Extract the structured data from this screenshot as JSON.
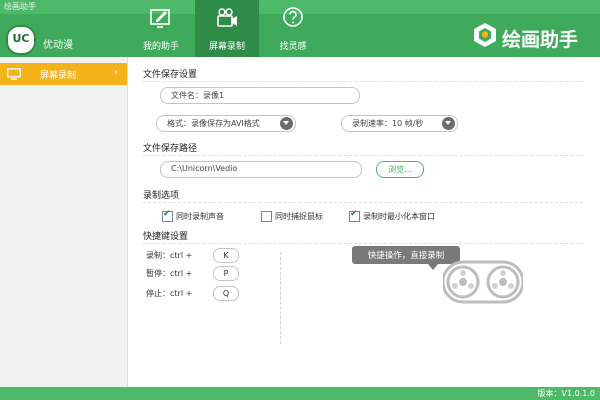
{
  "window": {
    "title": "绘画助手"
  },
  "user": {
    "logo_text": "UC",
    "name": "优动漫"
  },
  "tabs": [
    {
      "label": "我的助手",
      "icon": "palette-icon",
      "active": false
    },
    {
      "label": "屏幕录制",
      "icon": "video-camera-icon",
      "active": true
    },
    {
      "label": "找灵感",
      "icon": "question-icon",
      "active": false
    }
  ],
  "brand": {
    "text": "绘画助手"
  },
  "sidebar": {
    "items": [
      {
        "label": "屏幕录制",
        "icon": "monitor-icon",
        "arrow": "›"
      }
    ]
  },
  "file_save": {
    "title": "文件保存设置",
    "filename_label": "文件名：",
    "filename_value": "录像1",
    "format_label": "格式：",
    "format_value": "录像保存为AVI格式",
    "rate_label": "录制速率：",
    "rate_value": "10 帧/秒"
  },
  "save_path": {
    "title": "文件保存路径",
    "path": "C:\\Unicorn\\Vedio",
    "browse_label": "浏览..."
  },
  "options": {
    "title": "录制选项",
    "items": [
      {
        "label": "同时录制声音",
        "checked": true
      },
      {
        "label": "同时捕捉鼠标",
        "checked": false
      },
      {
        "label": "录制时最小化本窗口",
        "checked": true
      }
    ]
  },
  "hotkeys": {
    "title": "快捷键设置",
    "items": [
      {
        "label": "录制：ctrl +",
        "key": "K"
      },
      {
        "label": "暂停：ctrl +",
        "key": "P"
      },
      {
        "label": "停止：ctrl +",
        "key": "Q"
      }
    ]
  },
  "tip": {
    "text": "快捷操作，直接录制"
  },
  "footer": {
    "version": "版本：V1.0.1.0"
  },
  "colors": {
    "green": "#3fa95c",
    "active_tab": "#2e8c48",
    "sidebar_active": "#f5b31a"
  }
}
